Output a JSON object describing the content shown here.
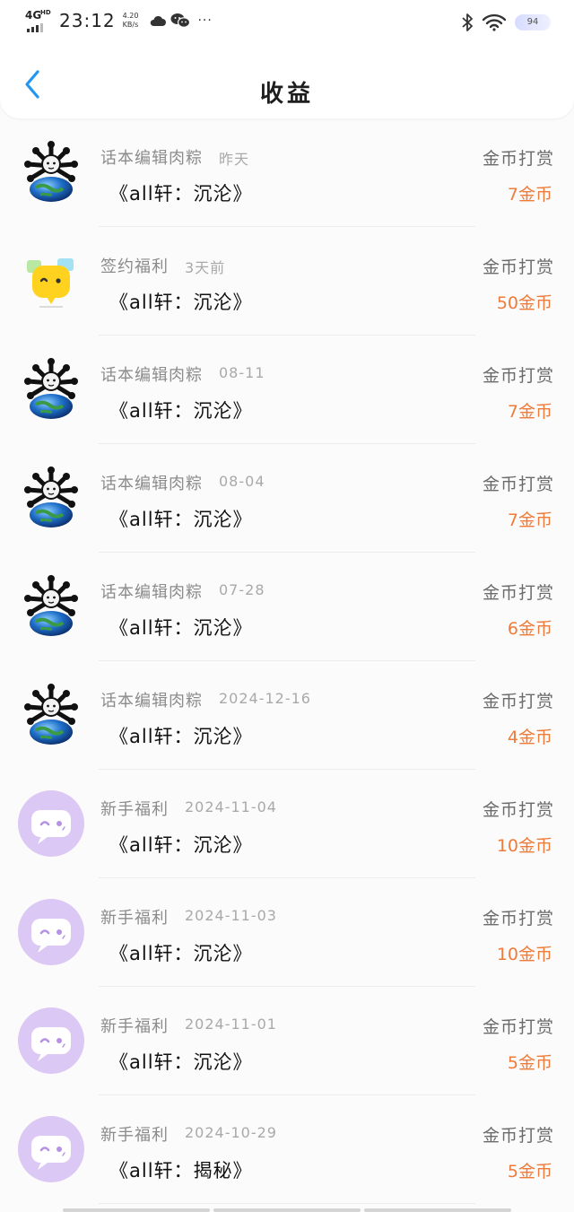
{
  "status_bar": {
    "network": "4G",
    "network_hd": "HD",
    "time": "23:12",
    "speed_value": "4.20",
    "speed_unit": "KB/s",
    "more": "···",
    "battery": "94"
  },
  "header": {
    "title": "收益"
  },
  "records": [
    {
      "source": "话本编辑肉粽",
      "date": "昨天",
      "work": "《all轩：沉沦》",
      "reward_type": "金币打赏",
      "amount": "7金币",
      "avatar": "editor-globe"
    },
    {
      "source": "签约福利",
      "date": "3天前",
      "work": "《all轩：沉沦》",
      "reward_type": "金币打赏",
      "amount": "50金币",
      "avatar": "yellow-bubble"
    },
    {
      "source": "话本编辑肉粽",
      "date": "08-11",
      "work": "《all轩：沉沦》",
      "reward_type": "金币打赏",
      "amount": "7金币",
      "avatar": "editor-globe"
    },
    {
      "source": "话本编辑肉粽",
      "date": "08-04",
      "work": "《all轩：沉沦》",
      "reward_type": "金币打赏",
      "amount": "7金币",
      "avatar": "editor-globe"
    },
    {
      "source": "话本编辑肉粽",
      "date": "07-28",
      "work": "《all轩：沉沦》",
      "reward_type": "金币打赏",
      "amount": "6金币",
      "avatar": "editor-globe"
    },
    {
      "source": "话本编辑肉粽",
      "date": "2024-12-16",
      "work": "《all轩：沉沦》",
      "reward_type": "金币打赏",
      "amount": "4金币",
      "avatar": "editor-globe"
    },
    {
      "source": "新手福利",
      "date": "2024-11-04",
      "work": "《all轩：沉沦》",
      "reward_type": "金币打赏",
      "amount": "10金币",
      "avatar": "purple-bubble"
    },
    {
      "source": "新手福利",
      "date": "2024-11-03",
      "work": "《all轩：沉沦》",
      "reward_type": "金币打赏",
      "amount": "10金币",
      "avatar": "purple-bubble"
    },
    {
      "source": "新手福利",
      "date": "2024-11-01",
      "work": "《all轩：沉沦》",
      "reward_type": "金币打赏",
      "amount": "5金币",
      "avatar": "purple-bubble"
    },
    {
      "source": "新手福利",
      "date": "2024-10-29",
      "work": "《all轩：揭秘》",
      "reward_type": "金币打赏",
      "amount": "5金币",
      "avatar": "purple-bubble"
    }
  ],
  "colors": {
    "accent_blue": "#2196f3",
    "amount_orange": "#ef7b3a",
    "purple_avatar": "#dcc8f5"
  }
}
